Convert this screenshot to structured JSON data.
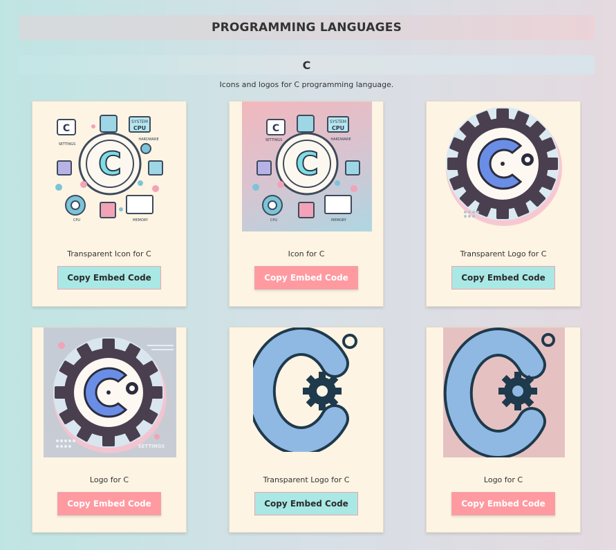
{
  "header": {
    "title": "PROGRAMMING LANGUAGES"
  },
  "section": {
    "title": "C",
    "description": "Icons and logos for C programming language."
  },
  "colors": {
    "card_bg": "#fdf4e3",
    "button_cyan": "#a9e8e5",
    "button_pink": "#ff9aa1"
  },
  "cards": [
    {
      "caption": "Transparent Icon for C",
      "button": "Copy Embed Code",
      "button_style": "cyan",
      "image_label": "c-icon-hardware-image",
      "image_texts": [
        "SYSTEM",
        "CPU",
        "SETTINGS",
        "HARDWARE",
        "CPU",
        "MEMORY"
      ]
    },
    {
      "caption": "Icon for C",
      "button": "Copy Embed Code",
      "button_style": "pink",
      "image_label": "c-icon-hardware-image",
      "image_texts": [
        "SYSTEM",
        "CPU",
        "SETTINGS",
        "HARDWARE",
        "CPU",
        "MEMORY"
      ]
    },
    {
      "caption": "Transparent Logo for C",
      "button": "Copy Embed Code",
      "button_style": "cyan",
      "image_label": "c-gear-logo-image"
    },
    {
      "caption": "Logo for C",
      "button": "Copy Embed Code",
      "button_style": "pink",
      "image_label": "c-gear-logo-image",
      "image_texts": [
        "SETTINGS"
      ]
    },
    {
      "caption": "Transparent Logo for C",
      "button": "Copy Embed Code",
      "button_style": "cyan",
      "image_label": "c-letter-gear-logo-image"
    },
    {
      "caption": "Logo for C",
      "button": "Copy Embed Code",
      "button_style": "pink",
      "image_label": "c-letter-gear-logo-image"
    }
  ]
}
